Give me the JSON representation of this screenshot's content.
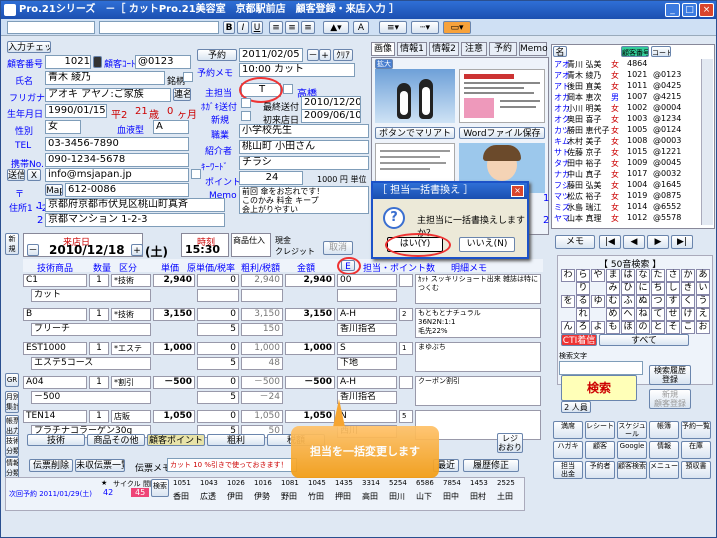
{
  "title": "Pro.21シリーズ　－［ カットPro.21美容室　京都駅前店　顧客登録・来店入力 ］",
  "window_buttons": [
    "_",
    "□",
    "×"
  ],
  "left_panel": {
    "input_check": "入力チェック",
    "labels": {
      "customer_no": "顧客番号",
      "name": "氏名",
      "furigana": "フリガナ",
      "birthday": "生年月日",
      "gender": "性別",
      "tel": "TEL",
      "mobile": "携帯No.",
      "email": "Email",
      "postal": "〒",
      "address": "住所1・2",
      "customer_code_label": "顧客ｺｰﾄﾞ"
    },
    "customer_no": "1021",
    "customer_code": "@0123",
    "name": "青木 綾乃",
    "furigana": "アオキ アヤノ:ご家族",
    "renraku": "連名",
    "birthday": "1990/01/15",
    "era": "平2",
    "age": "21",
    "age_unit": "歳",
    "months": "0",
    "months_unit": "ヶ月",
    "gender": "女",
    "blood_label": "血液型",
    "blood": "A",
    "tel": "03-3456-7890",
    "mobile": "090-1234-5678",
    "email": "info@msjapan.jp",
    "send_label": "送信",
    "x_label": "X",
    "map": "Map",
    "postal": "612-0086",
    "address1": "京都府京都市伏見区桃山町真斉",
    "address2": "京都マンション 1-2-3",
    "addr_no1": "1",
    "addr_no2": "2",
    "dm_label": "銘柄",
    "x_btn": "×",
    "dm_check": "✓"
  },
  "mid_panel": {
    "yoyaku": "予約",
    "date": "2011/02/05",
    "minus": "－",
    "plus": "+",
    "clear": "ｸﾘｱ",
    "memo_label": "予約メモ",
    "memo": "10:00 カット",
    "tantou_label": "主担当",
    "tantou": "T",
    "koukaku": "高橋",
    "hogo_label": "ﾎｶﾞｷ送付",
    "first_label": "最終送付",
    "first_date": "2010/12/20",
    "new_label": "新規",
    "shokai_label": "初来店日",
    "shokai_date": "2009/06/10",
    "job_label": "職業",
    "job": "小学校先生",
    "intro_label": "紹介者",
    "intro": "桃山町 小田さん",
    "keyword_label": "ｷｰﾜｰﾄﾞ",
    "keyword": "チラシ",
    "point_label": "ポイント",
    "point": "24",
    "point_unit": "1000 円 単位",
    "memo2_label": "Memo",
    "memo2": "前回 傘をお忘れです！\nこのかみ 料金 キープ\n会上がりやすい"
  },
  "tabs": [
    "画像",
    "情報1",
    "情報2",
    "注意",
    "予約",
    "Memo"
  ],
  "image_panel": {
    "expand": "拡大",
    "flyer_title": "",
    "btn_mari": "ボタンでマリアト",
    "btn_word": "Wordファイル保存",
    "customer_lbl": "顧客"
  },
  "customer_list": {
    "header_name": "名",
    "header_code": "顧客番号",
    "header_code2": "コード",
    "rows": [
      [
        "アオ",
        "青川 弘美",
        "女",
        "4864",
        ""
      ],
      [
        "アオ",
        "青木 綾乃",
        "女",
        "1021",
        "@0123"
      ],
      [
        "アト",
        "後田 直美",
        "女",
        "1011",
        "@0425"
      ],
      [
        "オカ",
        "岡本 恵次",
        "男",
        "1007",
        "@4215"
      ],
      [
        "オカ",
        "小川 明美",
        "女",
        "1002",
        "@0004"
      ],
      [
        "オク",
        "奥田 喜子",
        "女",
        "1003",
        "@1234"
      ],
      [
        "カツ",
        "勝田 恵代子",
        "女",
        "1005",
        "@0124"
      ],
      [
        "キム",
        "木村 美子",
        "女",
        "1008",
        "@0003"
      ],
      [
        "サト",
        "佐藤 京子",
        "女",
        "1015",
        "@1221"
      ],
      [
        "タナ",
        "田中 裕子",
        "女",
        "1009",
        "@0045"
      ],
      [
        "ナカ",
        "中山 真子",
        "女",
        "1017",
        "@0032"
      ],
      [
        "フジ",
        "藤田 弘美",
        "女",
        "1004",
        "@1645"
      ],
      [
        "マツ",
        "松広 裕子",
        "女",
        "1019",
        "@0875"
      ],
      [
        "ミズ",
        "水島 瑞江",
        "女",
        "1014",
        "@6552"
      ],
      [
        "ヤマ",
        "山本 真理",
        "女",
        "1012",
        "@5578"
      ]
    ],
    "row_nums": [
      "1",
      "2"
    ]
  },
  "visit": {
    "kiroku": "来店日",
    "date": "2010/12/18",
    "dow": "(土)",
    "jikoku_label": "時刻",
    "time": "15:30",
    "shouhin_label": "商品仕入",
    "genkin": "現金",
    "credit": "クレジット",
    "torikeshi": "取消",
    "side_label": "新規追加"
  },
  "table": {
    "headers": [
      "技術商品",
      "数量",
      "区分",
      "単価",
      "原単価/税率",
      "粗利/税額",
      "金額",
      "担当・ポイント数",
      "明細メモ"
    ],
    "rows": [
      {
        "item": "C1",
        "sub": "カット",
        "qty": "1",
        "kbn": "*技術",
        "price": "2,940",
        "cost": "0",
        "cost2": "",
        "gross": "2,940",
        "tax": "",
        "amount": "2,940",
        "staff": "00",
        "staff2": "",
        "pt": "",
        "memo": "ｶｯﾄ スッキリショート出来 雑誌は特につくむ"
      },
      {
        "item": "B",
        "sub": "ブリーチ",
        "qty": "1",
        "kbn": "*技術",
        "price": "3,150",
        "cost": "0",
        "cost2": "5",
        "gross": "3,150",
        "tax": "150",
        "amount": "3,150",
        "staff": "A-H",
        "staff2": "香川指名",
        "pt": "2",
        "memo": "もともとナチュラル\n36N2N:1:1\n毛先22%"
      },
      {
        "item": "EST1000",
        "sub": "エステ5コース",
        "qty": "1",
        "kbn": "*エステ",
        "price": "1,000",
        "cost": "0",
        "cost2": "5",
        "gross": "1,000",
        "tax": "48",
        "amount": "1,000",
        "staff": "S",
        "staff2": "下地",
        "pt": "1",
        "memo": "まゆぶち"
      },
      {
        "item": "A04",
        "sub": "－500",
        "qty": "1",
        "kbn": "*割引",
        "price": "－500",
        "cost": "0",
        "cost2": "5",
        "gross": "－500",
        "tax": "－24",
        "amount": "－500",
        "staff": "A-H",
        "staff2": "香川指名",
        "pt": "",
        "memo": "クーポン割引"
      },
      {
        "item": "TEN14",
        "sub": "プラチナコラーゲン30g",
        "qty": "1",
        "kbn": "店販",
        "price": "1,050",
        "cost": "0",
        "cost2": "5",
        "gross": "1,050",
        "tax": "50",
        "amount": "1,050",
        "staff": "N",
        "staff2": "西川",
        "pt": "5",
        "memo": ""
      }
    ],
    "edit_btn": "E"
  },
  "footer_tabs": [
    "技術",
    "商品その他",
    "顧客ポイント",
    "粗利",
    "税額"
  ],
  "bottom": {
    "voucher_del": "伝票削除",
    "voucher_list": "未収伝票一覧",
    "voucher_memo": "伝票メモ",
    "voucher_memo_text": "カット 10 %引きで使っておきます！",
    "saikin": "最近",
    "rireki": "履歴修正",
    "receipt": "レジ\nおおり",
    "next_label": "次回予約 2011/01/29(土)",
    "nums": [
      "42",
      "45"
    ],
    "stats": [
      "1051",
      "1043",
      "1026",
      "1016",
      "1081",
      "1045",
      "1435",
      "3314",
      "5254",
      "6586",
      "7854",
      "1453",
      "2525"
    ],
    "names": [
      "香田",
      "広透",
      "伊田",
      "伊勢",
      "野田",
      "竹田",
      "押田",
      "高田",
      "田川",
      "山下",
      "田中",
      "田村",
      "土田"
    ],
    "left_nums": [
      "★",
      "サイクル",
      "間隔"
    ]
  },
  "dialog": {
    "title": "［ 担当一括書換え ］",
    "message": "主担当に一括書換えしますか？",
    "yes": "はい(Y)",
    "no": "いいえ(N)"
  },
  "balloon": {
    "text": "担当を一括変更します"
  },
  "right_panel": {
    "memo": "メモ",
    "nav": [
      "|◀",
      "◀",
      "▶",
      "▶|"
    ],
    "kana_title": "【 50音検索 】",
    "kana": [
      "わ",
      "ら",
      "や",
      "ま",
      "は",
      "な",
      "た",
      "さ",
      "か",
      "あ",
      "",
      "り",
      "",
      "み",
      "ひ",
      "に",
      "ち",
      "し",
      "き",
      "い",
      "を",
      "る",
      "ゆ",
      "む",
      "ふ",
      "ぬ",
      "つ",
      "す",
      "く",
      "う",
      "",
      "れ",
      "",
      "め",
      "へ",
      "ね",
      "て",
      "せ",
      "け",
      "え",
      "ん",
      "ろ",
      "よ",
      "も",
      "ほ",
      "の",
      "と",
      "そ",
      "こ",
      "お"
    ],
    "cti": "CTI着信",
    "subete": "すべて",
    "search_label": "検索文字",
    "kensaku": "検索",
    "people": "2 人員",
    "rireki": "検索履歴\n登録",
    "shinki": "新規\n顧客登録",
    "btn_grid": [
      "満席",
      "レシート",
      "スケジュール",
      "帳簿",
      "予約一覧",
      "ハガキ",
      "顧客",
      "Google",
      "情報",
      "在庫",
      "担当\n出金",
      "予約者",
      "顧客検索",
      "メニュー",
      "預収書"
    ]
  },
  "left_side": [
    "新規追加",
    "GR",
    "月別\n集計",
    "帳票\n出力",
    "技術\n分類",
    "情報\n分類"
  ]
}
